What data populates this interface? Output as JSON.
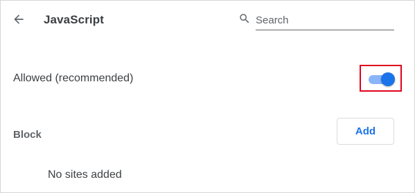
{
  "header": {
    "title": "JavaScript",
    "back_icon": "arrow-back-icon",
    "search": {
      "icon": "search-icon",
      "placeholder": "Search",
      "value": ""
    }
  },
  "allowed": {
    "label": "Allowed (recommended)",
    "toggle_state": "on"
  },
  "block": {
    "label": "Block",
    "add_label": "Add",
    "empty_text": "No sites added"
  },
  "colors": {
    "accent": "#1a73e8",
    "toggle_track": "#8ab4f8",
    "highlight": "#e0001b",
    "text": "#3c4043"
  }
}
